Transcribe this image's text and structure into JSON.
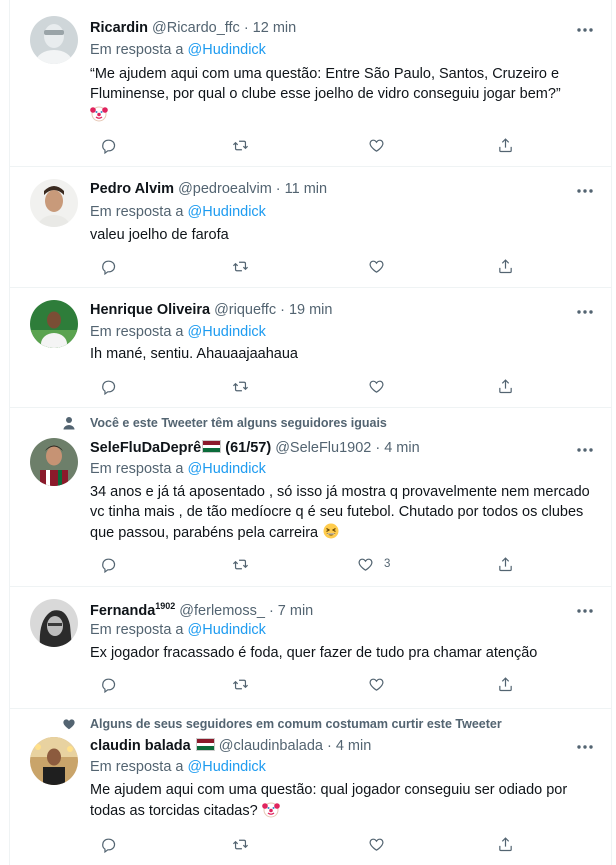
{
  "reply_prefix": "Em resposta a",
  "tweets": [
    {
      "name": "Ricardin",
      "handle": "@Ricardo_ffc",
      "time": "12 min",
      "reply_to": "@Hudindick",
      "text": "“Me ajudem aqui com uma questão: Entre São Paulo, Santos, Cruzeiro e Fluminense, por qual o clube esse joelho de vidro conseguiu jogar bem?”",
      "emoji": "clown-face"
    },
    {
      "name": "Pedro Alvim",
      "handle": "@pedroealvim",
      "time": "11 min",
      "reply_to": "@Hudindick",
      "text": "valeu joelho de farofa"
    },
    {
      "name": "Henrique Oliveira",
      "handle": "@riqueffc",
      "time": "19 min",
      "reply_to": "@Hudindick",
      "text": "Ih mané, sentiu. Ahauaajaahaua"
    },
    {
      "social": "Você e este Tweeter têm alguns seguidores iguais",
      "social_icon": "person-icon",
      "name": "SeleFluDaDeprê",
      "name_suffix": "(61/57)",
      "flag_colors": [
        "#8b1a2b",
        "#ffffff",
        "#0b6b3a"
      ],
      "handle": "@SeleFlu1902",
      "time": "4 min",
      "reply_to": "@Hudindick",
      "text": "34 anos e já tá aposentado , só isso já mostra q provavelmente nem mercado vc tinha mais , de tão medíocre q é seu futebol. Chutado por todos os clubes que passou, parabéns pela carreira",
      "emoji": "grinning-squinting-face",
      "like_count": "3"
    },
    {
      "name": "Fernanda",
      "name_sup": "1902",
      "handle": "@ferlemoss_",
      "time": "7 min",
      "reply_to": "@Hudindick",
      "text": "Ex jogador fracassado é foda, quer fazer de tudo pra chamar atenção"
    },
    {
      "social": "Alguns de seus seguidores em comum costumam curtir este Tweeter",
      "social_icon": "heart-icon",
      "name": "claudin balada",
      "flag_colors": [
        "#8b1a2b",
        "#ffffff",
        "#0b6b3a"
      ],
      "handle": "@claudinbalada",
      "time": "4 min",
      "reply_to": "@Hudindick",
      "text": "Me ajudem aqui com uma questão: qual jogador conseguiu ser odiado por todas as torcidas citadas?",
      "emoji": "clown-face"
    }
  ],
  "colors": {
    "accent": "#1d9bf0",
    "secondary_text": "#536471",
    "divider": "#eff3f4"
  }
}
